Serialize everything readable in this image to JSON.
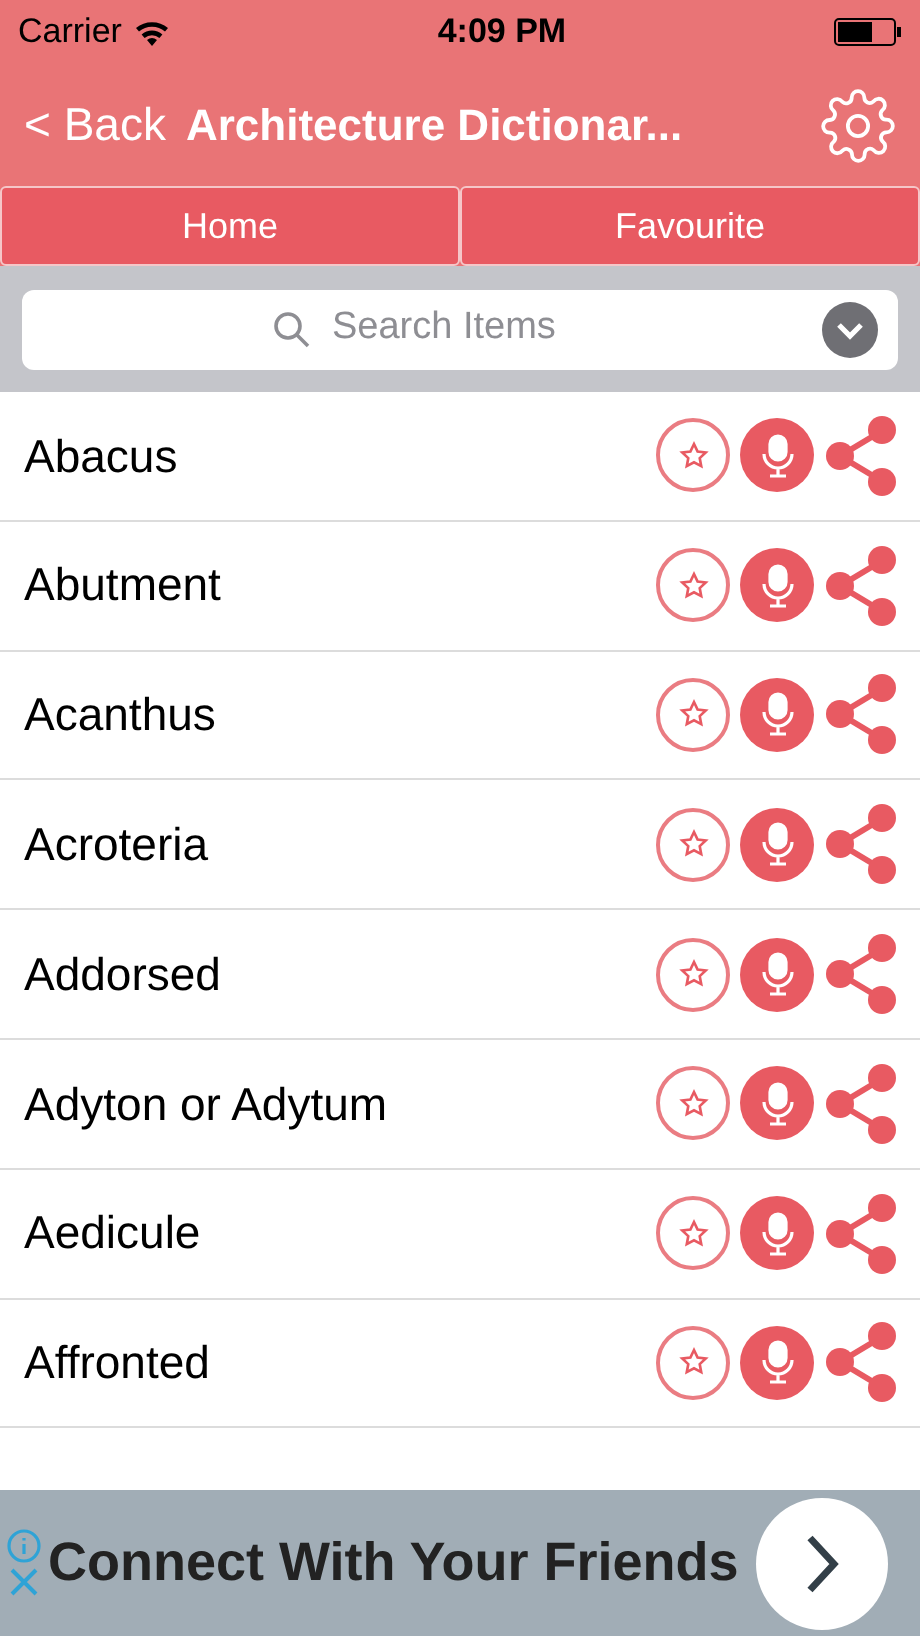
{
  "status_bar": {
    "carrier": "Carrier",
    "time": "4:09 PM"
  },
  "nav": {
    "back": "< Back",
    "title": "Architecture Dictionar..."
  },
  "tabs": [
    {
      "label": "Home"
    },
    {
      "label": "Favourite"
    }
  ],
  "search": {
    "placeholder": "Search Items"
  },
  "items": [
    {
      "term": "Abacus"
    },
    {
      "term": "Abutment"
    },
    {
      "term": "Acanthus"
    },
    {
      "term": "Acroteria"
    },
    {
      "term": "Addorsed"
    },
    {
      "term": "Adyton or Adytum"
    },
    {
      "term": "Aedicule"
    },
    {
      "term": "Affronted"
    }
  ],
  "ad": {
    "headline": "Connect With Your Friends"
  }
}
